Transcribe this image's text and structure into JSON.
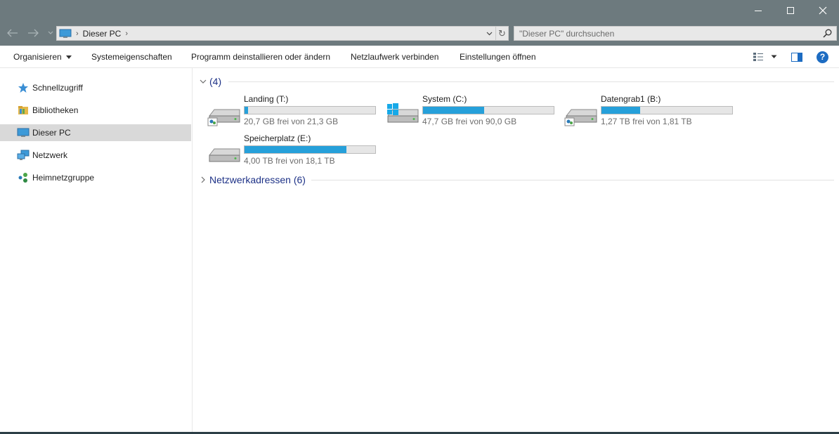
{
  "titlebar": {
    "minimize_icon": "minimize-icon",
    "maximize_icon": "maximize-icon",
    "close_icon": "close-icon"
  },
  "address": {
    "crumb": "Dieser PC"
  },
  "search": {
    "placeholder": "\"Dieser PC\" durchsuchen"
  },
  "toolbar": {
    "organize": "Organisieren",
    "system_properties": "Systemeigenschaften",
    "uninstall": "Programm deinstallieren oder ändern",
    "map_drive": "Netzlaufwerk verbinden",
    "settings": "Einstellungen öffnen",
    "help": "?"
  },
  "sidebar": {
    "items": [
      {
        "label": "Schnellzugriff",
        "icon": "star-icon"
      },
      {
        "label": "Bibliotheken",
        "icon": "library-icon"
      },
      {
        "label": "Dieser PC",
        "icon": "computer-icon",
        "selected": true
      },
      {
        "label": "Netzwerk",
        "icon": "network-icon"
      },
      {
        "label": "Heimnetzgruppe",
        "icon": "homegroup-icon"
      }
    ]
  },
  "main": {
    "drives_group": {
      "title": "(4)"
    },
    "network_group": {
      "title": "Netzwerkadressen (6)"
    },
    "drives": [
      {
        "name": "Landing (T:)",
        "info": "20,7 GB frei von 21,3 GB",
        "used_fraction": 0.028,
        "icon": "network-drive-icon"
      },
      {
        "name": "System (C:)",
        "info": "47,7 GB frei von 90,0 GB",
        "used_fraction": 0.47,
        "icon": "windows-drive-icon"
      },
      {
        "name": "Datengrab1 (B:)",
        "info": "1,27 TB frei von 1,81 TB",
        "used_fraction": 0.298,
        "icon": "network-drive-icon"
      },
      {
        "name": "Speicherplatz (E:)",
        "info": "4,00 TB frei von 18,1 TB",
        "used_fraction": 0.779,
        "icon": "hard-drive-icon"
      }
    ]
  },
  "colors": {
    "titlebar": "#6d7a7e",
    "bar_fill": "#26a0da",
    "group_title": "#1e3287",
    "selected": "#d9d9d9"
  }
}
